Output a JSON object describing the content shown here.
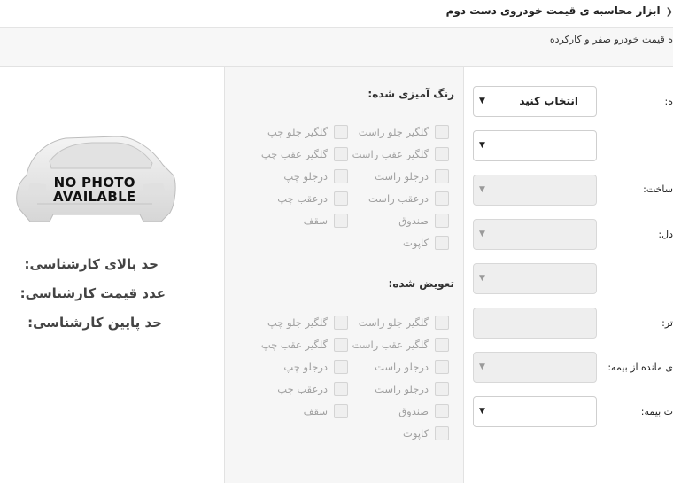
{
  "header": {
    "breadcrumb": "ابزار محاسبه ی قیمت خودروی دست دوم",
    "subtitle": "ه قیمت خودرو صفر و کارکرده"
  },
  "left_panel": {
    "photo_caption_line1": "NO PHOTO",
    "photo_caption_line2": "AVAILABLE",
    "expert_labels": [
      "حد بالای کارشناسی:",
      "عدد قیمت کارشناسی:",
      "حد پایین کارشناسی:"
    ]
  },
  "painted_section": {
    "title": "رنگ آمیزی شده:",
    "items": [
      "گلگیر جلو راست",
      "گلگیر جلو چپ",
      "گلگیر عقب راست",
      "گلگیر عقب چپ",
      "درجلو راست",
      "درجلو چپ",
      "درعقب راست",
      "درعقب چپ",
      "صندوق",
      "سقف",
      "کاپوت"
    ]
  },
  "replaced_section": {
    "title": "تعویض شده:",
    "items": [
      "گلگیر جلو راست",
      "گلگیر جلو چپ",
      "گلگیر عقب راست",
      "گلگیر عقب چپ",
      "درجلو راست",
      "درجلو چپ",
      "درجلو راست",
      "درعقب چپ",
      "صندوق",
      "سقف",
      "کاپوت"
    ]
  },
  "form": {
    "select_placeholder": "انتخاب کنید",
    "labels": [
      "ه:",
      "ساخت:",
      "دل:",
      "تر:",
      "ی مانده از بیمه:",
      "ت بیمه:"
    ]
  }
}
